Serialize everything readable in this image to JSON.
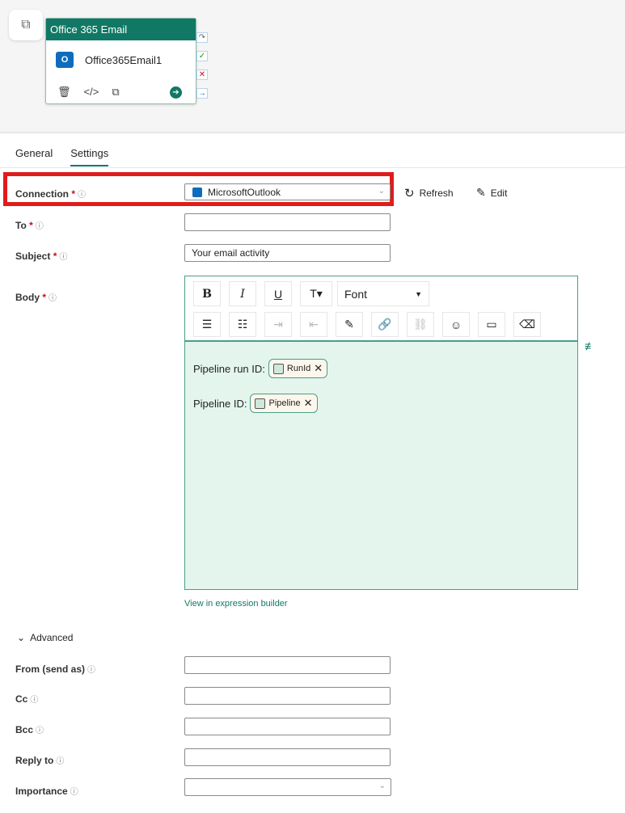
{
  "canvas": {
    "node_title": "Office 365 Email",
    "node_name": "Office365Email1",
    "icon": "outlook-icon"
  },
  "tabs": [
    {
      "label": "General"
    },
    {
      "label": "Settings",
      "active": true
    }
  ],
  "connection": {
    "label": "Connection",
    "value": "MicrosoftOutlook",
    "refresh": "Refresh",
    "edit": "Edit"
  },
  "to": {
    "label": "To",
    "value": ""
  },
  "subject": {
    "label": "Subject",
    "value": "Your email activity"
  },
  "body": {
    "label": "Body",
    "font": "Font",
    "lines": [
      {
        "text": "Pipeline run ID:",
        "chip": "RunId"
      },
      {
        "text": "Pipeline ID:",
        "chip": "Pipeline"
      }
    ],
    "expression_link": "View in expression builder"
  },
  "advanced": {
    "label": "Advanced",
    "fields": [
      {
        "label": "From (send as)"
      },
      {
        "label": "Cc"
      },
      {
        "label": "Bcc"
      },
      {
        "label": "Reply to"
      },
      {
        "label": "Importance"
      }
    ]
  },
  "colors": {
    "accent": "#117865",
    "highlight": "#e01b1b",
    "editor_bg": "#e3f5ec"
  }
}
